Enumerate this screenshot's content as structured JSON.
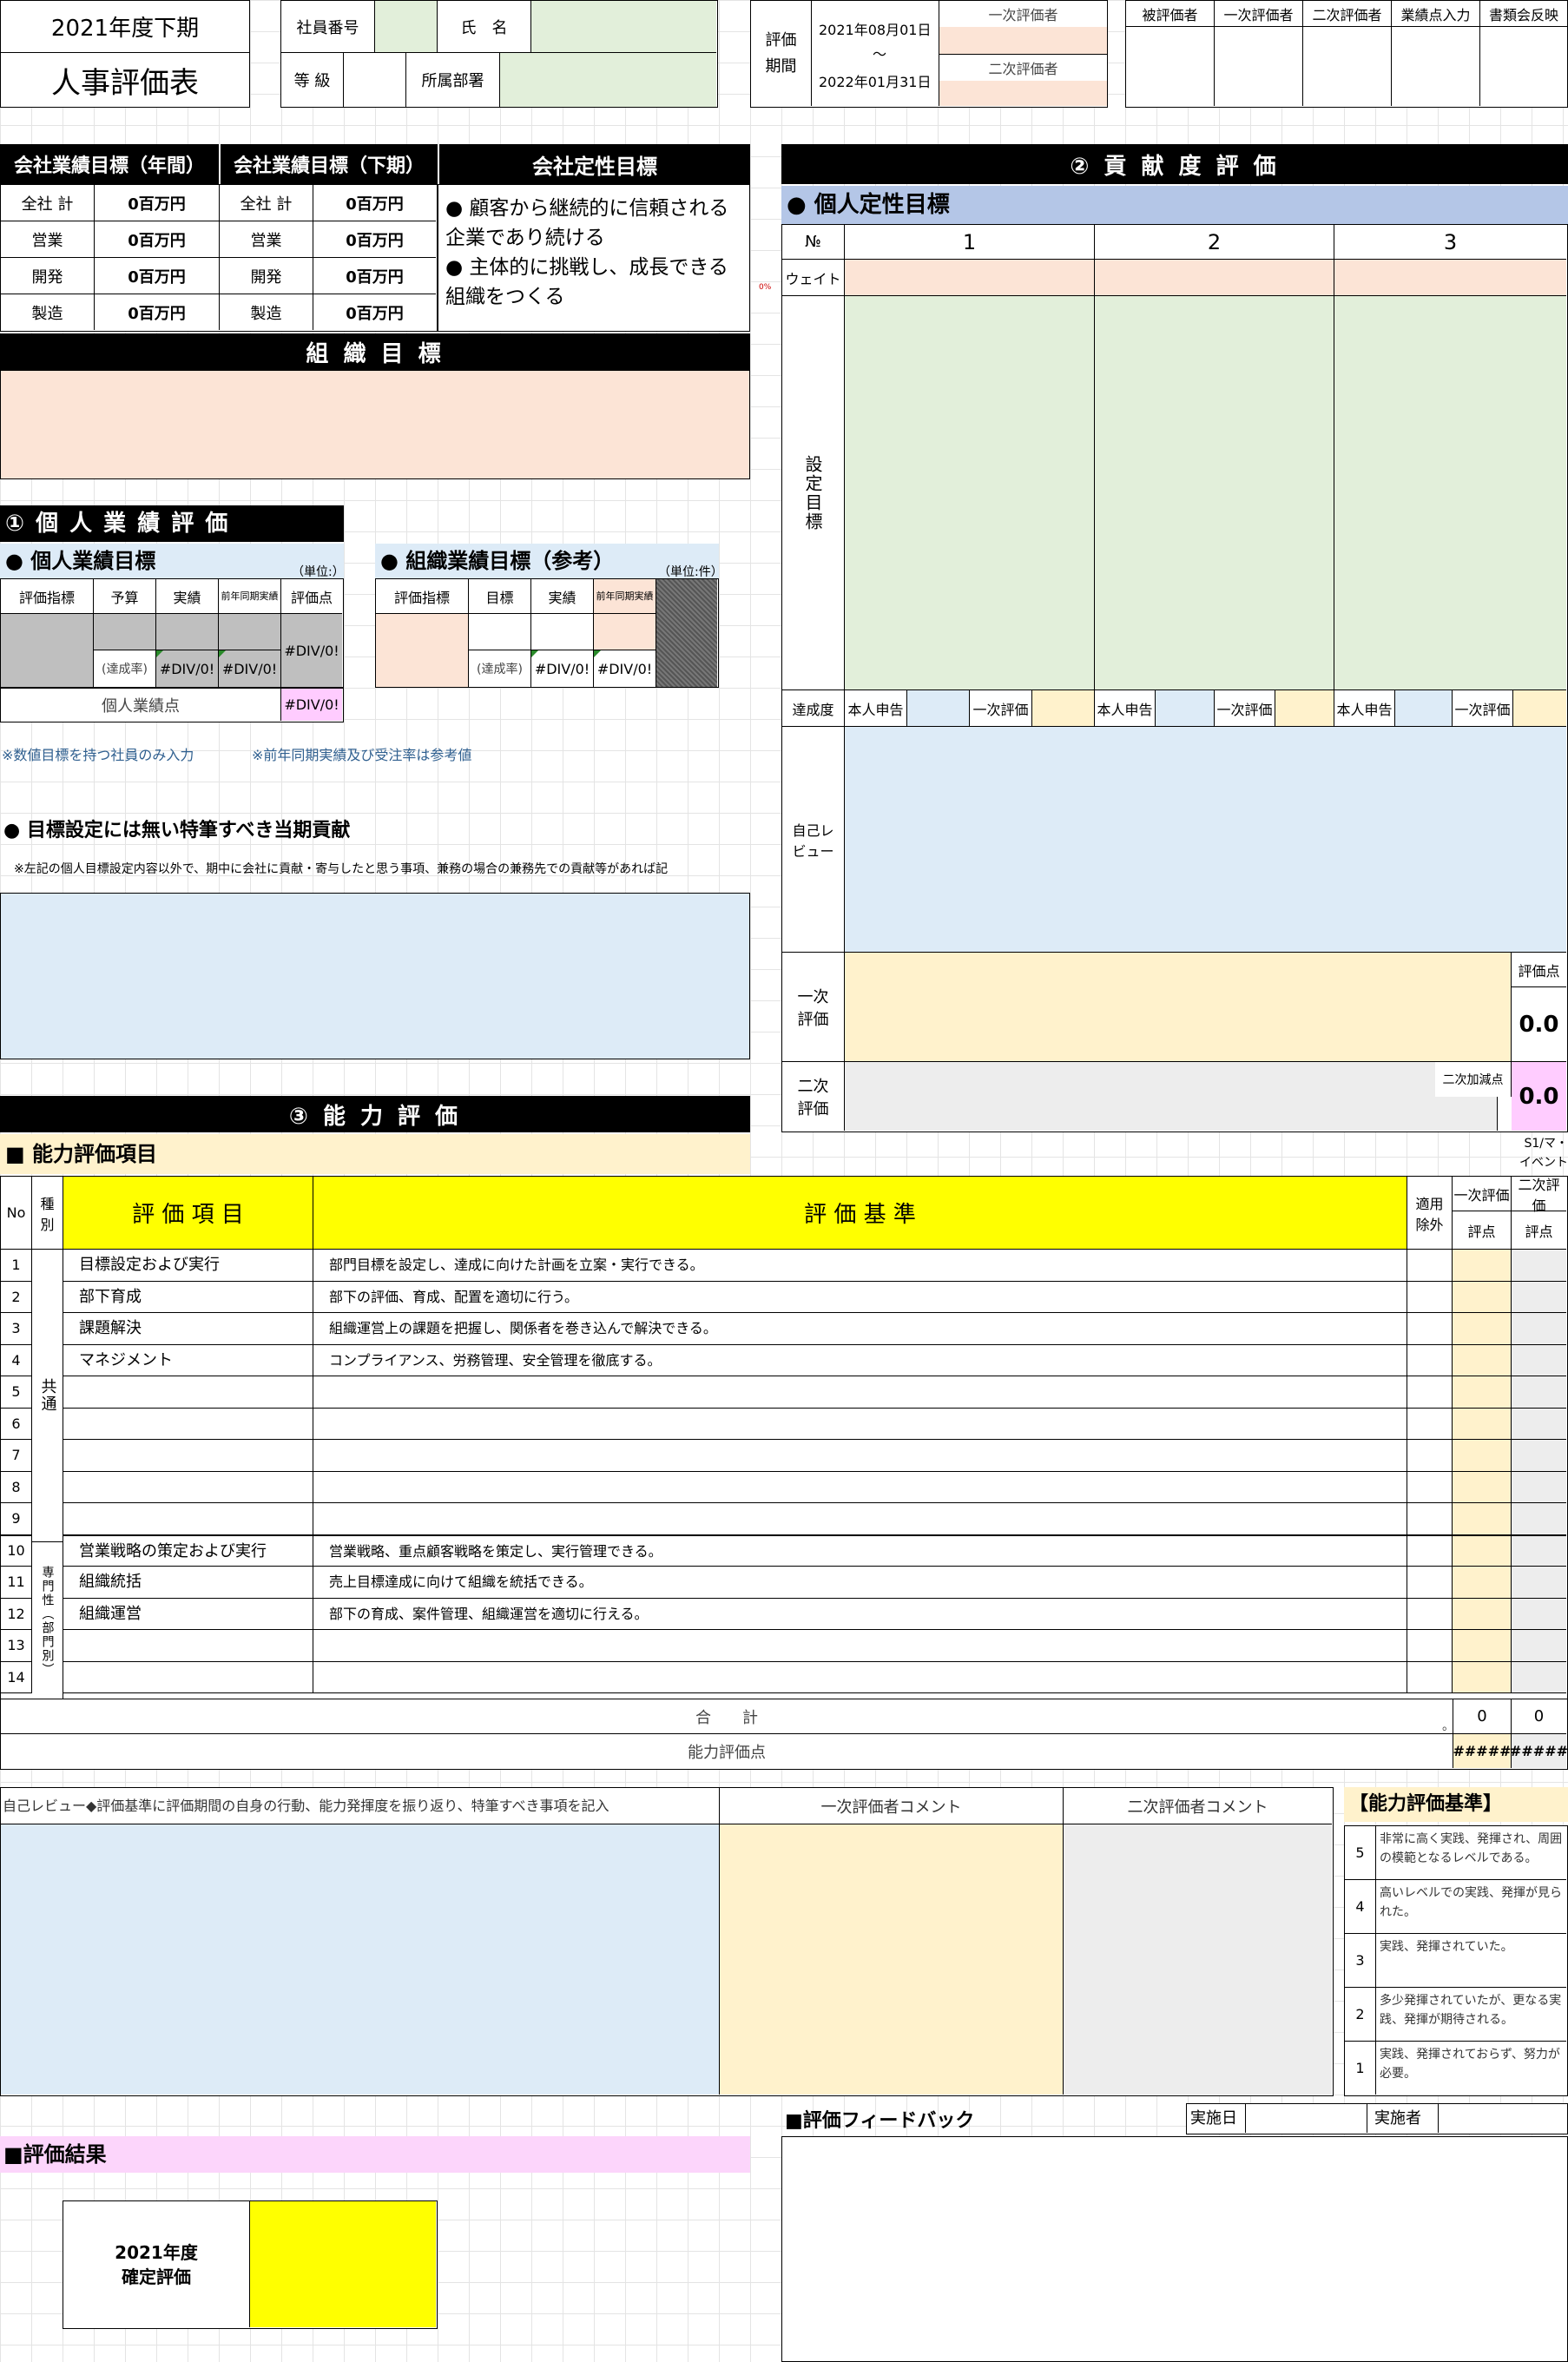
{
  "header": {
    "term": "2021年度下期",
    "title": "人事評価表",
    "employee_no_label": "社員番号",
    "name_label": "氏　名",
    "grade_label": "等 級",
    "dept_label": "所属部署",
    "eval_period_label": "評価期間",
    "period_start": "2021年08月01日",
    "period_sep": "～",
    "period_end": "2022年01月31日",
    "first_evaluator": "一次評価者",
    "second_evaluator": "二次評価者",
    "stamps": [
      "被評価者",
      "一次評価者",
      "二次評価者",
      "業績点入力",
      "書類会反映"
    ]
  },
  "company": {
    "annual_title": "会社業績目標（年間）",
    "second_half_title": "会社業績目標（下期）",
    "qualitative_title": "会社定性目標",
    "rows": [
      {
        "label": "全社 計",
        "annual": "0百万円",
        "half": "0百万円"
      },
      {
        "label": "営業",
        "annual": "0百万円",
        "half": "0百万円"
      },
      {
        "label": "開発",
        "annual": "0百万円",
        "half": "0百万円"
      },
      {
        "label": "製造",
        "annual": "0百万円",
        "half": "0百万円"
      }
    ],
    "qualitative": [
      "● 顧客から継続的に信頼される企業であり続ける",
      "● 主体的に挑戦し、成長できる組織をつくる"
    ],
    "org_goal_title": "組 織 目 標"
  },
  "perf": {
    "section_title": "① 個 人 業 績 評 価",
    "personal_title": "● 個人業績目標",
    "unit_personal": "（単位:）",
    "org_title": "● 組織業績目標（参考）",
    "unit_org": "（単位:件）",
    "p_cols": [
      "評価指標",
      "予算",
      "実績",
      "前年同期実績",
      "評価点"
    ],
    "o_cols": [
      "評価指標",
      "目標",
      "実績",
      "前年同期実績"
    ],
    "rate": "(達成率)",
    "div": "#DIV/0!",
    "score_label": "個人業績点",
    "note1": "※数値目標を持つ社員のみ入力",
    "note2": "※前年同期実績及び受注率は参考値",
    "special_title": "● 目標設定には無い特筆すべき当期貢献",
    "special_note": "※左記の個人目標設定内容以外で、期中に会社に貢献・寄与したと思う事項、兼務の場合の兼務先での貢献等があれば記"
  },
  "contrib": {
    "title": "② 貢 献 度 評 価",
    "qual_title": "● 個人定性目標",
    "no_label": "№",
    "cols": [
      "1",
      "2",
      "3"
    ],
    "weight_label": "ウェイト",
    "weight_pct": "0%",
    "goal_label": "設定目標",
    "achieve_label": "達成度",
    "self_report": "本人申告",
    "first_eval": "一次評価",
    "self_review_label": "自己レビュー",
    "first_label": "一次評価",
    "second_label": "二次評価",
    "score_label": "評価点",
    "score": "0.0",
    "adj_label": "二次加減点",
    "adj": "0.0"
  },
  "ability": {
    "section_title": "③ 能 力 評 価",
    "items_title": "■ 能力評価項目",
    "s_note": "S1/マ・イベント",
    "col_no": "No",
    "col_kind": "種別",
    "col_item": "評 価 項 目",
    "col_crit": "評 価 基 準",
    "col_excl": "適用除外",
    "col_first": "一次評価",
    "col_second": "二次評価",
    "col_pt": "評点",
    "kind_common": "共通",
    "kind_special": "専門性（部門別）",
    "rows": [
      {
        "no": "1",
        "item": "目標設定および実行",
        "crit": "部門目標を設定し、達成に向けた計画を立案・実行できる。"
      },
      {
        "no": "2",
        "item": "部下育成",
        "crit": "部下の評価、育成、配置を適切に行う。"
      },
      {
        "no": "3",
        "item": "課題解決",
        "crit": "組織運営上の課題を把握し、関係者を巻き込んで解決できる。"
      },
      {
        "no": "4",
        "item": "マネジメント",
        "crit": "コンプライアンス、労務管理、安全管理を徹底する。"
      },
      {
        "no": "5",
        "item": "",
        "crit": ""
      },
      {
        "no": "6",
        "item": "",
        "crit": ""
      },
      {
        "no": "7",
        "item": "",
        "crit": ""
      },
      {
        "no": "8",
        "item": "",
        "crit": ""
      },
      {
        "no": "9",
        "item": "",
        "crit": ""
      },
      {
        "no": "10",
        "item": "営業戦略の策定および実行",
        "crit": "営業戦略、重点顧客戦略を策定し、実行管理できる。"
      },
      {
        "no": "11",
        "item": "組織統括",
        "crit": "売上目標達成に向けて組織を統括できる。"
      },
      {
        "no": "12",
        "item": "組織運営",
        "crit": "部下の育成、案件管理、組織運営を適切に行える。"
      },
      {
        "no": "13",
        "item": "",
        "crit": ""
      },
      {
        "no": "14",
        "item": "",
        "crit": ""
      }
    ],
    "total_label": "合　　計",
    "total_first": "0",
    "total_second": "0",
    "total_dot": "。",
    "point_label": "能力評価点",
    "hash": "#####"
  },
  "review": {
    "self_label": "自己レビュー◆評価基準に評価期間の自身の行動、能力発揮度を振り返り、特筆すべき事項を記入",
    "first_comment": "一次評価者コメント",
    "second_comment": "二次評価者コメント",
    "criteria_title": "【能力評価基準】",
    "criteria": [
      {
        "n": "5",
        "t": "非常に高く実践、発揮され、周囲の模範となるレベルである。"
      },
      {
        "n": "4",
        "t": "高いレベルでの実践、発揮が見られた。"
      },
      {
        "n": "3",
        "t": "実践、発揮されていた。"
      },
      {
        "n": "2",
        "t": "多少発揮されていたが、更なる実践、発揮が期待される。"
      },
      {
        "n": "1",
        "t": "実践、発揮されておらず、努力が必要。"
      }
    ]
  },
  "result": {
    "title": "■評価結果",
    "year_label": "2021年度\n確定評価",
    "feedback_title": "■評価フィードバック",
    "date_label": "実施日",
    "by_label": "実施者"
  }
}
